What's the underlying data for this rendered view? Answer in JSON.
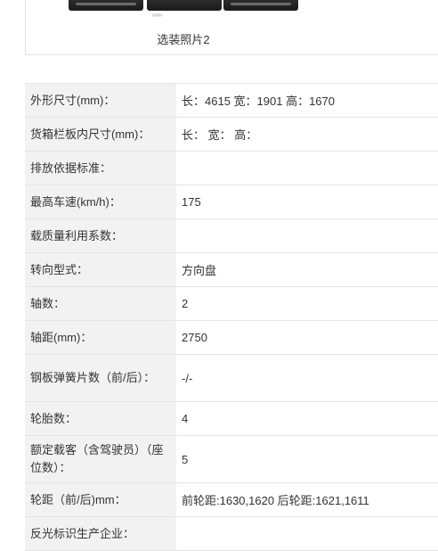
{
  "photos": {
    "label": "选装照片2",
    "thumb_caption": "选装照片"
  },
  "specs": [
    {
      "key": "外形尺寸(mm)：",
      "value": "长：4615 宽：1901 高：1670"
    },
    {
      "key": "货箱栏板内尺寸(mm)：",
      "value": "长： 宽： 高："
    },
    {
      "key": "排放依据标准：",
      "value": ""
    },
    {
      "key": "最高车速(km/h)：",
      "value": "175"
    },
    {
      "key": "载质量利用系数：",
      "value": ""
    },
    {
      "key": "转向型式：",
      "value": "方向盘"
    },
    {
      "key": "轴数：",
      "value": "2"
    },
    {
      "key": "轴距(mm)：",
      "value": "2750"
    },
    {
      "key": "钢板弹簧片数（前/后）：",
      "value": "-/-"
    },
    {
      "key": "轮胎数：",
      "value": "4"
    },
    {
      "key": "额定载客（含驾驶员）（座位数）：",
      "value": "5"
    },
    {
      "key": "轮距（前/后)mm：",
      "value": "前轮距:1630,1620 后轮距:1621,1611"
    },
    {
      "key": "反光标识生产企业：",
      "value": ""
    }
  ]
}
